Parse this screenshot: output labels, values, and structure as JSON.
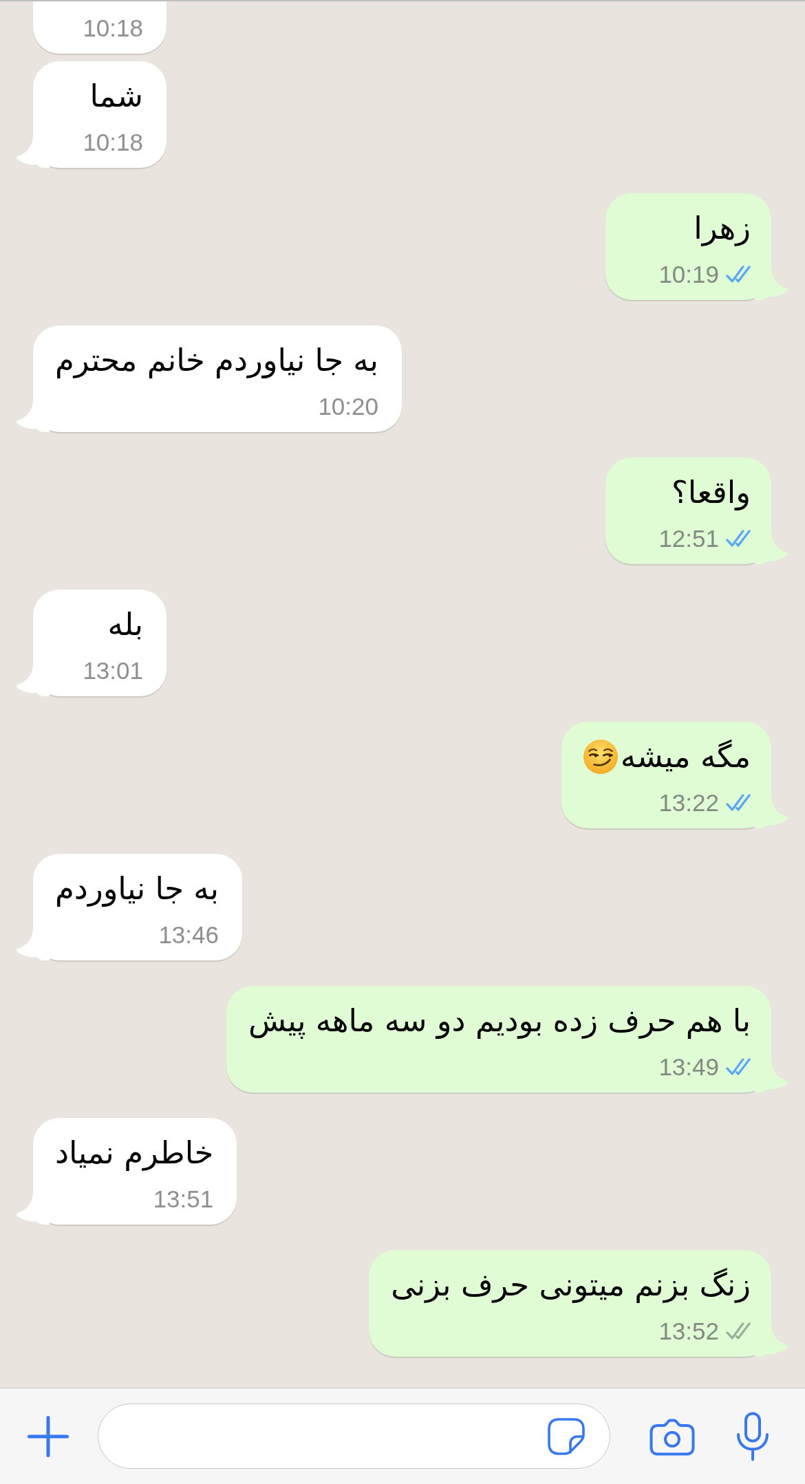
{
  "messages": [
    {
      "kind": "incoming",
      "tail": false,
      "time": "10:18"
    },
    {
      "kind": "incoming",
      "tail": true,
      "text": "شما",
      "time": "10:18"
    },
    {
      "kind": "outgoing",
      "tail": true,
      "text": "زهرا",
      "time": "10:19",
      "read": true
    },
    {
      "kind": "incoming",
      "tail": true,
      "text": "به جا نیاوردم خانم محترم",
      "time": "10:20"
    },
    {
      "kind": "outgoing",
      "tail": true,
      "text": "واقعا؟",
      "time": "12:51",
      "read": true
    },
    {
      "kind": "incoming",
      "tail": true,
      "text": "بله",
      "time": "13:01"
    },
    {
      "kind": "outgoing",
      "tail": true,
      "text": "مگه میشه",
      "emoji": true,
      "time": "13:22",
      "read": true
    },
    {
      "kind": "incoming",
      "tail": true,
      "text": "به جا نیاوردم",
      "time": "13:46"
    },
    {
      "kind": "outgoing",
      "tail": true,
      "text": "با هم حرف زده بودیم دو سه ماهه پیش",
      "time": "13:49",
      "read": true
    },
    {
      "kind": "incoming",
      "tail": true,
      "text": "خاطرم نمیاد",
      "time": "13:51"
    },
    {
      "kind": "outgoing",
      "tail": true,
      "text": "زنگ بزنم میتونی حرف بزنی",
      "time": "13:52",
      "read": false
    }
  ]
}
